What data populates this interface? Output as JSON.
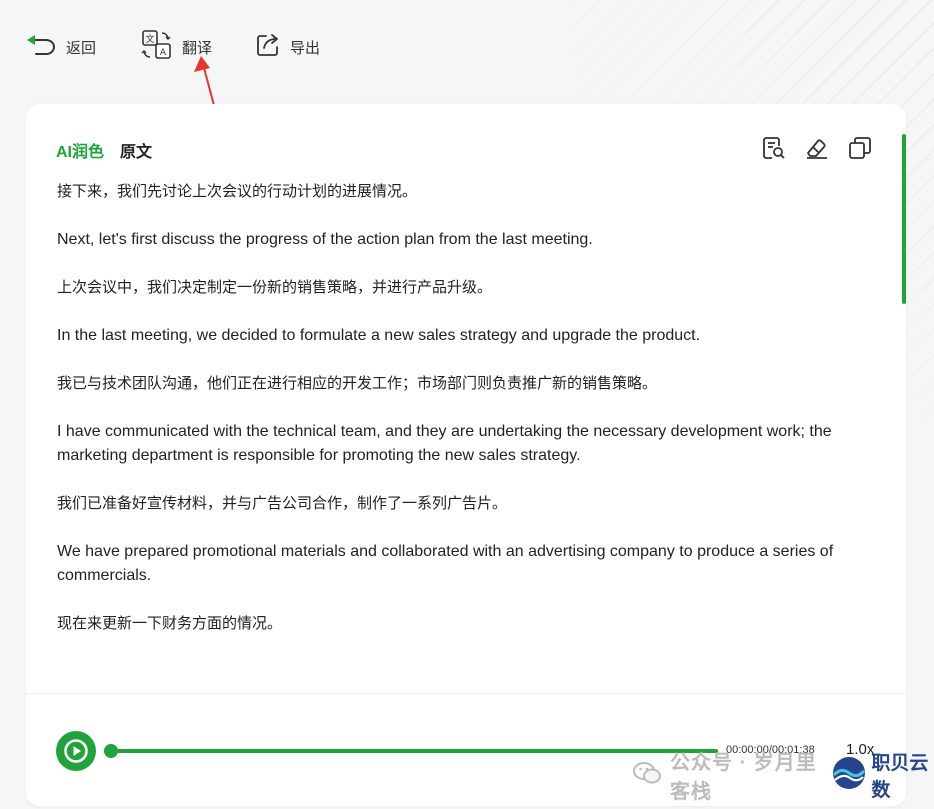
{
  "topbar": {
    "back_label": "返回",
    "translate_label": "翻译",
    "export_label": "导出"
  },
  "tabs": [
    {
      "label": "AI润色",
      "active": true
    },
    {
      "label": "原文",
      "active": false
    }
  ],
  "tools": [
    "search-document-icon",
    "eraser-icon",
    "copy-icon"
  ],
  "paragraphs": [
    {
      "lang": "zh",
      "text": "接下来，我们先讨论上次会议的行动计划的进展情况。"
    },
    {
      "lang": "en",
      "text": "Next, let's first discuss the progress of the action plan from the last meeting."
    },
    {
      "lang": "zh",
      "text": "上次会议中，我们决定制定一份新的销售策略，并进行产品升级。"
    },
    {
      "lang": "en",
      "text": "In the last meeting, we decided to formulate a new sales strategy and upgrade the product."
    },
    {
      "lang": "zh",
      "text": "我已与技术团队沟通，他们正在进行相应的开发工作；市场部门则负责推广新的销售策略。"
    },
    {
      "lang": "en",
      "text": "I have communicated with the technical team, and they are undertaking the necessary development work; the marketing department is responsible for promoting the new sales strategy."
    },
    {
      "lang": "zh",
      "text": "我们已准备好宣传材料，并与广告公司合作，制作了一系列广告片。"
    },
    {
      "lang": "en",
      "text": "We have prepared promotional materials and collaborated with an advertising company to produce a series of commercials."
    },
    {
      "lang": "zh",
      "text": "现在来更新一下财务方面的情况。"
    }
  ],
  "player": {
    "time": "00:00:00/00:01:38",
    "speed": "1.0x",
    "progress": 0
  },
  "watermark": {
    "text": "公众号 · 岁月里客栈",
    "brand": "职贝云数"
  },
  "colors": {
    "accent": "#1fa33a",
    "annotation_arrow": "#e8352b"
  }
}
